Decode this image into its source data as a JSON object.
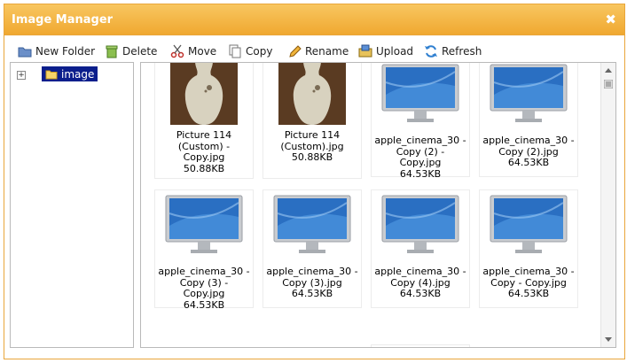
{
  "window": {
    "title": "Image Manager",
    "close_symbol": "✖"
  },
  "toolbar": {
    "new_folder": "New Folder",
    "delete": "Delete",
    "move": "Move",
    "copy": "Copy",
    "rename": "Rename",
    "upload": "Upload",
    "refresh": "Refresh"
  },
  "tree": {
    "toggle": "+",
    "root_label": "image"
  },
  "files": [
    {
      "name": "Picture 114 (Custom) - Copy.jpg",
      "size": "50.88KB",
      "kind": "vase"
    },
    {
      "name": "Picture 114 (Custom).jpg",
      "size": "50.88KB",
      "kind": "vase"
    },
    {
      "name": "apple_cinema_30 - Copy (2) - Copy.jpg",
      "size": "64.53KB",
      "kind": "monitor"
    },
    {
      "name": "apple_cinema_30 - Copy (2).jpg",
      "size": "64.53KB",
      "kind": "monitor"
    },
    {
      "name": "apple_cinema_30 - Copy (3) - Copy.jpg",
      "size": "64.53KB",
      "kind": "monitor"
    },
    {
      "name": "apple_cinema_30 - Copy (3).jpg",
      "size": "64.53KB",
      "kind": "monitor"
    },
    {
      "name": "apple_cinema_30 - Copy (4).jpg",
      "size": "64.53KB",
      "kind": "monitor"
    },
    {
      "name": "apple_cinema_30 - Copy - Copy.jpg",
      "size": "64.53KB",
      "kind": "monitor"
    }
  ],
  "colors": {
    "header": "#f0a830",
    "selected_node": "#0b1e8c"
  }
}
